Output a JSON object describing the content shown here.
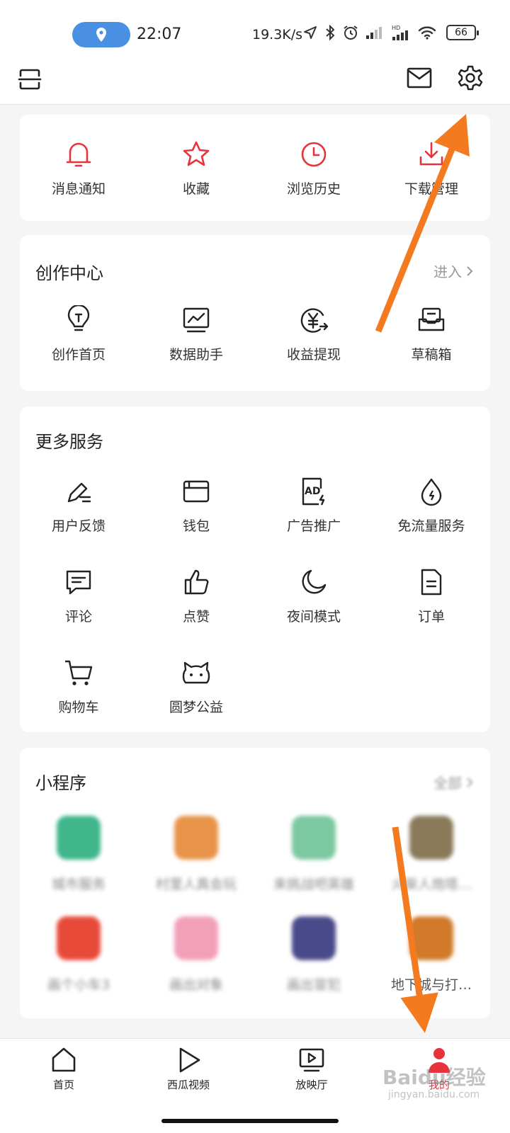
{
  "status_bar": {
    "time": "22:07",
    "net_speed": "19.3K/s",
    "battery": "66",
    "icons": [
      "location-icon",
      "navigation-icon",
      "bluetooth-icon",
      "alarm-icon",
      "signal-icon",
      "hd-signal-icon",
      "wifi-icon",
      "battery-icon"
    ]
  },
  "top_bar": {
    "icons": [
      "scan-icon",
      "mail-icon",
      "settings-icon"
    ]
  },
  "quick_actions": [
    {
      "label": "消息通知",
      "icon": "bell-icon"
    },
    {
      "label": "收藏",
      "icon": "star-icon"
    },
    {
      "label": "浏览历史",
      "icon": "clock-icon"
    },
    {
      "label": "下载管理",
      "icon": "download-icon"
    }
  ],
  "creation_center": {
    "title": "创作中心",
    "more": "进入",
    "items": [
      {
        "label": "创作首页",
        "icon": "lightbulb-icon"
      },
      {
        "label": "数据助手",
        "icon": "chart-monitor-icon"
      },
      {
        "label": "收益提现",
        "icon": "yuan-withdraw-icon"
      },
      {
        "label": "草稿箱",
        "icon": "drafts-box-icon"
      }
    ]
  },
  "more_services": {
    "title": "更多服务",
    "items": [
      {
        "label": "用户反馈",
        "icon": "pen-feedback-icon"
      },
      {
        "label": "钱包",
        "icon": "wallet-icon"
      },
      {
        "label": "广告推广",
        "icon": "ad-icon"
      },
      {
        "label": "免流量服务",
        "icon": "data-drop-icon"
      },
      {
        "label": "评论",
        "icon": "comment-icon"
      },
      {
        "label": "点赞",
        "icon": "thumbs-up-icon"
      },
      {
        "label": "夜间模式",
        "icon": "moon-icon"
      },
      {
        "label": "订单",
        "icon": "order-document-icon"
      },
      {
        "label": "购物车",
        "icon": "cart-icon"
      },
      {
        "label": "圆梦公益",
        "icon": "charity-cat-icon"
      }
    ]
  },
  "mini_programs": {
    "title": "小程序",
    "more": "全部",
    "items": [
      {
        "label": "城市服务",
        "color": "#3fb68b",
        "blurred": true
      },
      {
        "label": "村里人真会玩",
        "color": "#e8934a",
        "blurred": true
      },
      {
        "label": "来挑战吧英雄",
        "color": "#7cc8a0",
        "blurred": true
      },
      {
        "label": "火柴人炮塔…",
        "color": "#8a7a5a",
        "blurred": true
      },
      {
        "label": "画个小车3",
        "color": "#e84a3a",
        "blurred": true
      },
      {
        "label": "画出对象",
        "color": "#f2a0b8",
        "blurred": true
      },
      {
        "label": "画出冒犯",
        "color": "#4a4a8a",
        "blurred": true
      },
      {
        "label": "地下城与打…",
        "color": "#d07a2a",
        "blurred": false
      }
    ]
  },
  "bottom_nav": [
    {
      "label": "首页",
      "icon": "home-icon",
      "active": false
    },
    {
      "label": "西瓜视频",
      "icon": "play-icon",
      "active": false
    },
    {
      "label": "放映厅",
      "icon": "screening-hall-icon",
      "active": false
    },
    {
      "label": "我的",
      "icon": "profile-icon",
      "active": true
    }
  ],
  "watermark": {
    "text": "Baidu经验",
    "sub": "jingyan.baidu.com"
  },
  "colors": {
    "accent": "#e8333c",
    "annotation_arrow": "#f47a20",
    "location_pill": "#4a90e2"
  }
}
